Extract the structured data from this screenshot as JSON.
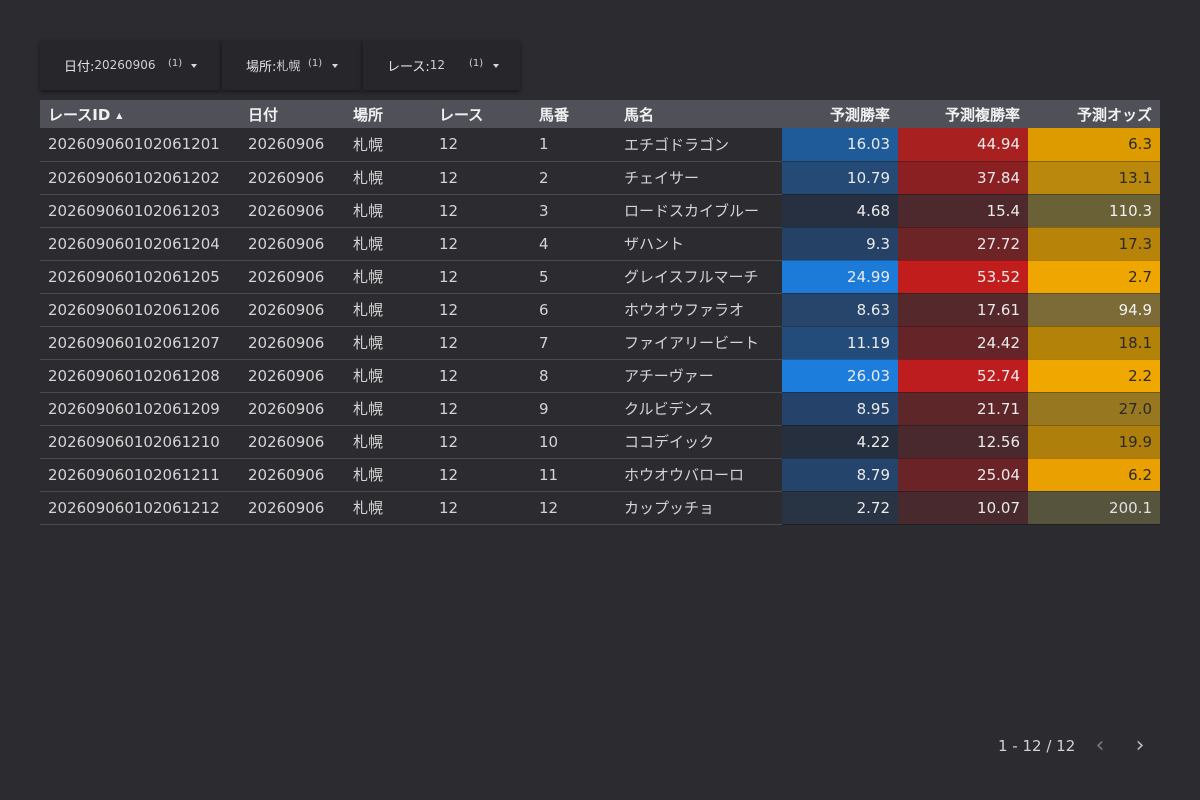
{
  "filters": [
    {
      "label": "日付:",
      "value": "20260906",
      "count": "(1)"
    },
    {
      "label": "場所:",
      "value": "札幌",
      "count": "(1)"
    },
    {
      "label": "レース:",
      "value": "12",
      "count": "(1)"
    }
  ],
  "table": {
    "columns": [
      "レースID",
      "日付",
      "場所",
      "レース",
      "馬番",
      "馬名",
      "予測勝率",
      "予測複勝率",
      "予測オッズ"
    ],
    "sort_icon": "sort-ascending-icon",
    "rows": [
      [
        "202609060102061201",
        "20260906",
        "札幌",
        "12",
        "1",
        "エチゴドラゴン",
        "16.03",
        "44.94",
        "6.3"
      ],
      [
        "202609060102061202",
        "20260906",
        "札幌",
        "12",
        "2",
        "チェイサー",
        "10.79",
        "37.84",
        "13.1"
      ],
      [
        "202609060102061203",
        "20260906",
        "札幌",
        "12",
        "3",
        "ロードスカイブルー",
        "4.68",
        "15.4",
        "110.3"
      ],
      [
        "202609060102061204",
        "20260906",
        "札幌",
        "12",
        "4",
        "ザハント",
        "9.3",
        "27.72",
        "17.3"
      ],
      [
        "202609060102061205",
        "20260906",
        "札幌",
        "12",
        "5",
        "グレイスフルマーチ",
        "24.99",
        "53.52",
        "2.7"
      ],
      [
        "202609060102061206",
        "20260906",
        "札幌",
        "12",
        "6",
        "ホウオウファラオ",
        "8.63",
        "17.61",
        "94.9"
      ],
      [
        "202609060102061207",
        "20260906",
        "札幌",
        "12",
        "7",
        "ファイアリービート",
        "11.19",
        "24.42",
        "18.1"
      ],
      [
        "202609060102061208",
        "20260906",
        "札幌",
        "12",
        "8",
        "アチーヴァー",
        "26.03",
        "52.74",
        "2.2"
      ],
      [
        "202609060102061209",
        "20260906",
        "札幌",
        "12",
        "9",
        "クルビデンス",
        "8.95",
        "21.71",
        "27.0"
      ],
      [
        "202609060102061210",
        "20260906",
        "札幌",
        "12",
        "10",
        "ココデイック",
        "4.22",
        "12.56",
        "19.9"
      ],
      [
        "202609060102061211",
        "20260906",
        "札幌",
        "12",
        "11",
        "ホウオウバローロ",
        "8.79",
        "25.04",
        "6.2"
      ],
      [
        "202609060102061212",
        "20260906",
        "札幌",
        "12",
        "12",
        "カップッチョ",
        "2.72",
        "10.07",
        "200.1"
      ]
    ],
    "heat_colors": {
      "win": [
        "#1f5a99",
        "#244a75",
        "#263041",
        "#254165",
        "#1c7ad8",
        "#27446a",
        "#234c7b",
        "#1c7ddd",
        "#25436a",
        "#262f3e",
        "#25446c",
        "#283444"
      ],
      "place": [
        "#a8201f",
        "#8a2022",
        "#4d292d",
        "#6c2427",
        "#c11d1d",
        "#55282c",
        "#652528",
        "#bd1d1f",
        "#5d272a",
        "#4a292e",
        "#6a2427",
        "#47292e"
      ],
      "odds": [
        "#de9b00",
        "#b9880c",
        "#6a6236",
        "#b78409",
        "#f0a600",
        "#7c6b36",
        "#b38208",
        "#f0a700",
        "#977720",
        "#af7f0c",
        "#e9a000",
        "#56543c"
      ],
      "odds_text": [
        "#2a2a2a",
        "#2a2a2a",
        "#f0f0f0",
        "#2a2a2a",
        "#2a2a2a",
        "#f0f0f0",
        "#2a2a2a",
        "#2a2a2a",
        "#2a2a2a",
        "#2a2a2a",
        "#2a2a2a",
        "#e0e0e0"
      ]
    }
  },
  "pagination": {
    "label": "1 - 12 / 12",
    "prev_icon": "chevron-left-icon",
    "next_icon": "chevron-right-icon"
  }
}
